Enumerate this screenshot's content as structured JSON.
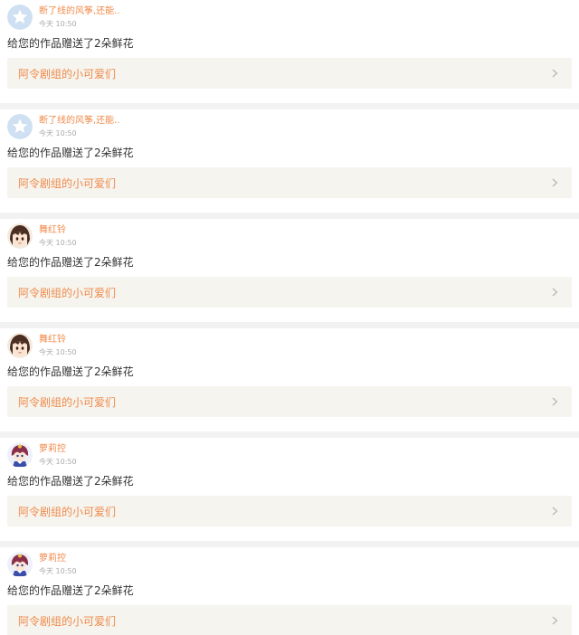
{
  "notifications": [
    {
      "username": "断了线的风筝,还能..",
      "time": "今天 10:50",
      "message": "给您的作品赠送了2朵鲜花",
      "work_title": "阿令剧组的小可爱们",
      "avatar": "star-avatar"
    },
    {
      "username": "断了线的风筝,还能..",
      "time": "今天 10:50",
      "message": "给您的作品赠送了2朵鲜花",
      "work_title": "阿令剧组的小可爱们",
      "avatar": "star-avatar"
    },
    {
      "username": "舞红铃",
      "time": "今天 10:50",
      "message": "给您的作品赠送了2朵鲜花",
      "work_title": "阿令剧组的小可爱们",
      "avatar": "anime-girl-avatar"
    },
    {
      "username": "舞红铃",
      "time": "今天 10:50",
      "message": "给您的作品赠送了2朵鲜花",
      "work_title": "阿令剧组的小可爱们",
      "avatar": "anime-girl-avatar"
    },
    {
      "username": "萝莉控",
      "time": "今天 10:50",
      "message": "给您的作品赠送了2朵鲜花",
      "work_title": "阿令剧组的小可爱们",
      "avatar": "chibi-avatar"
    },
    {
      "username": "萝莉控",
      "time": "今天 10:50",
      "message": "给您的作品赠送了2朵鲜花",
      "work_title": "阿令剧组的小可爱们",
      "avatar": "chibi-avatar"
    }
  ],
  "colors": {
    "accent": "#f08a4b",
    "link_bg": "#f5f4ee",
    "separator": "#f2f2f2"
  },
  "icons": {
    "chevron": "chevron-right-icon"
  }
}
